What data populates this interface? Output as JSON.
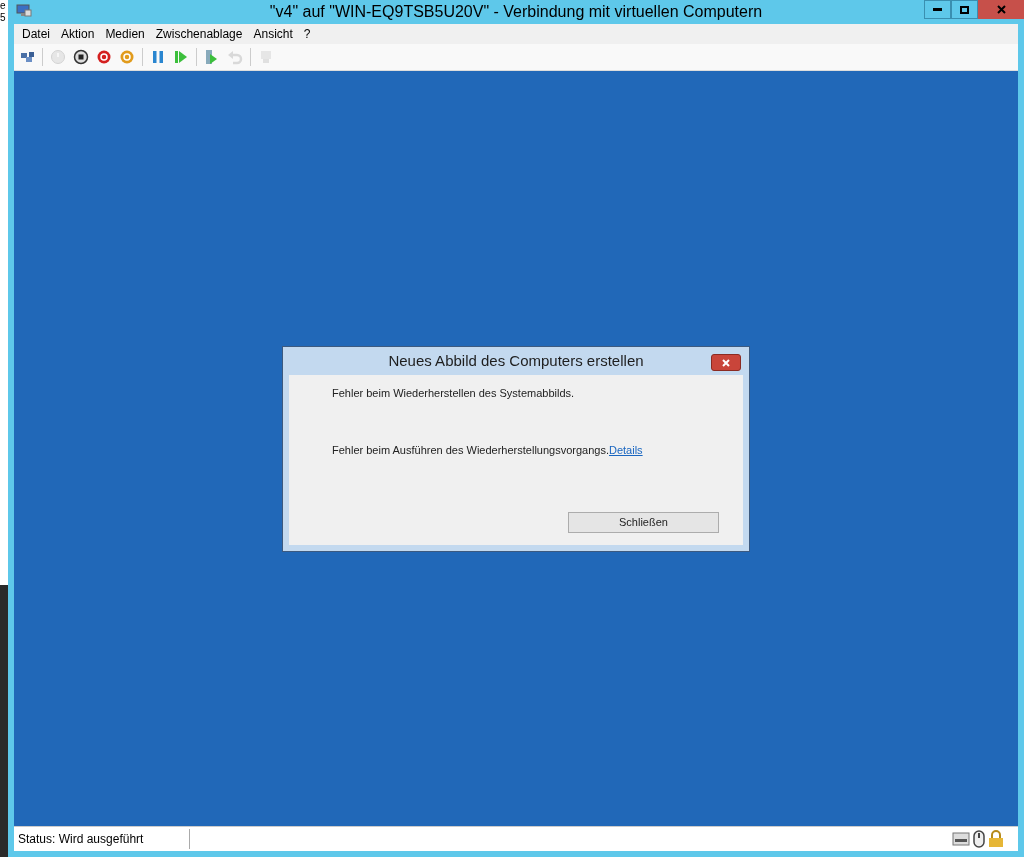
{
  "background_window": {
    "texts": [
      "e",
      "5"
    ]
  },
  "window": {
    "title": "\"v4\" auf \"WIN-EQ9TSB5U20V\" - Verbindung mit virtuellen Computern"
  },
  "menu": [
    "Datei",
    "Aktion",
    "Medien",
    "Zwischenablage",
    "Ansicht",
    "?"
  ],
  "toolbar": [
    {
      "kind": "ctrl-alt-del",
      "disabled": false
    },
    {
      "kind": "sep"
    },
    {
      "kind": "start",
      "disabled": true
    },
    {
      "kind": "turn-off",
      "disabled": false
    },
    {
      "kind": "shutdown",
      "disabled": false
    },
    {
      "kind": "save",
      "disabled": false
    },
    {
      "kind": "sep"
    },
    {
      "kind": "pause",
      "disabled": false
    },
    {
      "kind": "resume",
      "disabled": false
    },
    {
      "kind": "sep"
    },
    {
      "kind": "checkpoint",
      "disabled": false
    },
    {
      "kind": "revert",
      "disabled": true
    },
    {
      "kind": "sep"
    },
    {
      "kind": "enhanced",
      "disabled": true
    }
  ],
  "dialog": {
    "title": "Neues Abbild des Computers erstellen",
    "message": "Fehler beim Wiederherstellen des Systemabbilds.",
    "detail": "Fehler beim Ausführen des Wiederherstellungsvorgangs.",
    "link": "Details",
    "button": "Schließen"
  },
  "status_bar": {
    "text": "Status: Wird ausgeführt"
  }
}
